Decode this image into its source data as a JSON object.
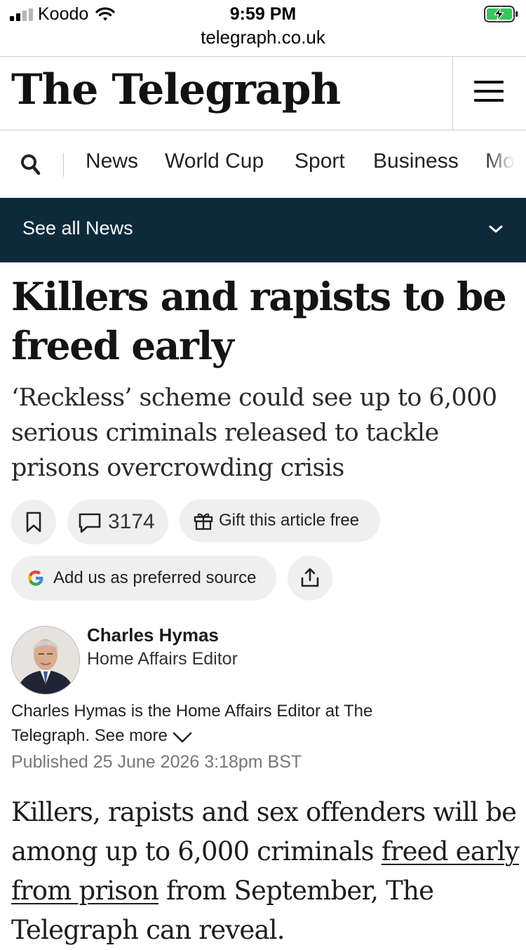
{
  "status_bar": {
    "carrier": "Koodo",
    "time": "9:59 PM",
    "url": "telegraph.co.uk"
  },
  "masthead": {
    "logo_text": "The Telegraph",
    "menu_icon": "hamburger-menu-icon"
  },
  "nav": {
    "search_icon": "search-icon",
    "items": [
      "News",
      "World Cup",
      "Sport",
      "Business",
      "Mo"
    ]
  },
  "section_bar": {
    "label": "See all News",
    "icon": "chevron-down-icon"
  },
  "article": {
    "headline": "Killers and rapists to be freed early",
    "standfirst": "‘Reckless’ scheme could see up to 6,000 serious criminals released to tackle prisons overcrowding crisis",
    "comment_count": "3174",
    "gift_label": "Gift this article free",
    "preferred_source_label": "Add us as preferred source",
    "author": {
      "name": "Charles Hymas",
      "role": "Home Affairs Editor",
      "bio": "Charles Hymas is the Home Affairs Editor at The Telegraph.",
      "see_more": "See more"
    },
    "published": "Published 25 June 2026 3:18pm BST",
    "body_before_link": "Killers, rapists and sex offenders will be among up to 6,000 criminals ",
    "body_link": "freed early from prison",
    "body_after_link": " from September, The Telegraph can reveal."
  },
  "colors": {
    "section_bar_bg": "#0d2a3b",
    "pill_bg": "#efefef",
    "published_text": "#777777"
  }
}
